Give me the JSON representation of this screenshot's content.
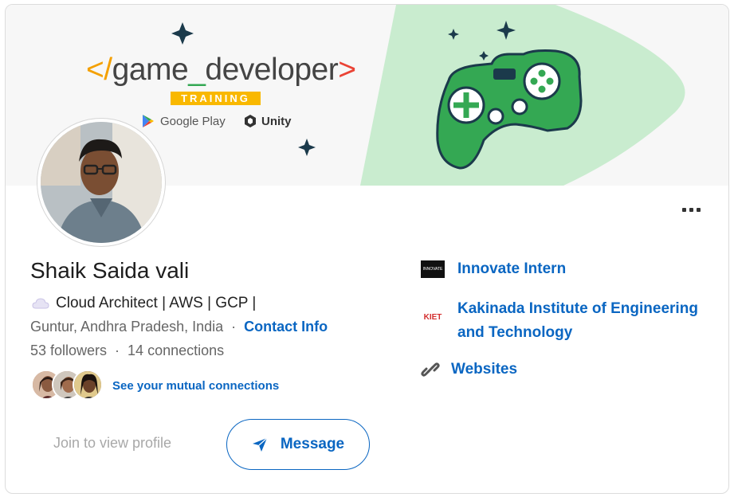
{
  "banner": {
    "logo_prefix": "</",
    "logo_word1": "game",
    "logo_underscore": "_",
    "logo_word2": "developer",
    "logo_suffix": ">",
    "training": "TRAINING",
    "google_play": "Google Play",
    "unity": "Unity",
    "colors": {
      "green": "#c9eccf",
      "controller": "#34a853",
      "star": "#1b3a4b",
      "training_bg": "#f9b800"
    }
  },
  "profile": {
    "name": "Shaik Saida vali",
    "headline": "Cloud Architect | AWS | GCP |",
    "location": "Guntur, Andhra Pradesh, India",
    "separator": "·",
    "contact_info": "Contact Info",
    "followers": "53 followers",
    "connections": "14 connections",
    "mutual_link": "See your mutual connections"
  },
  "actions": {
    "join": "Join to view profile",
    "message": "Message"
  },
  "right_panel": {
    "company": "Innovate Intern",
    "company_logo_text": "INNOVATE",
    "school_line1": "Kakinada Institute of Engineering",
    "school_line2": "and Technology",
    "school_logo_text": "KIET",
    "websites": "Websites"
  },
  "accent": "#0a66c2"
}
